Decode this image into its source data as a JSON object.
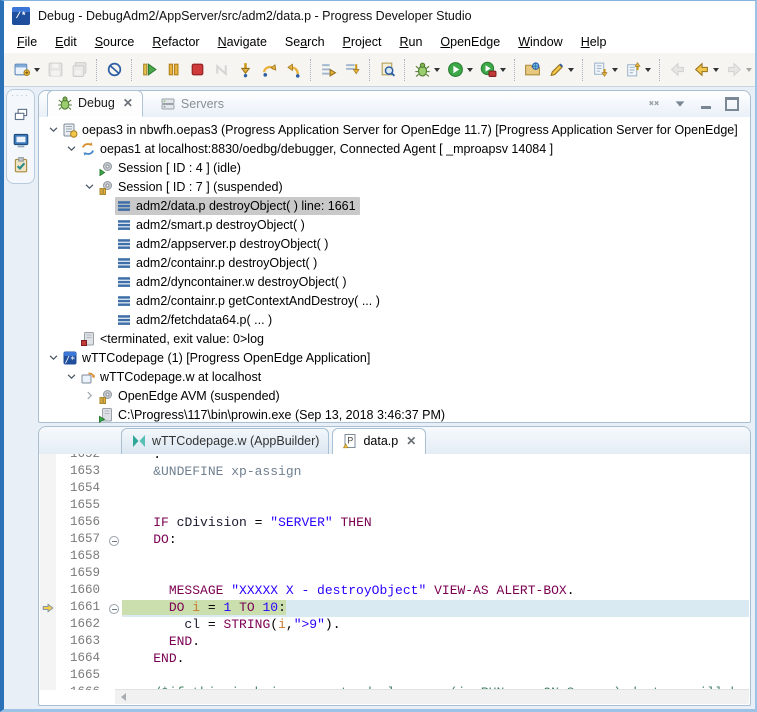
{
  "window": {
    "title": "Debug - DebugAdm2/AppServer/src/adm2/data.p - Progress Developer Studio",
    "app_icon": "progress-developer-studio-icon"
  },
  "menu": {
    "items": [
      {
        "label": "File",
        "u": 0
      },
      {
        "label": "Edit",
        "u": 0
      },
      {
        "label": "Source",
        "u": 0
      },
      {
        "label": "Refactor",
        "u": 0
      },
      {
        "label": "Navigate",
        "u": 0
      },
      {
        "label": "Search",
        "u": 2
      },
      {
        "label": "Project",
        "u": 0
      },
      {
        "label": "Run",
        "u": 0
      },
      {
        "label": "OpenEdge",
        "u": 0
      },
      {
        "label": "Window",
        "u": 0
      },
      {
        "label": "Help",
        "u": 0
      }
    ]
  },
  "toolbar": {
    "groups": [
      {
        "buttons": [
          {
            "name": "new-wizard",
            "icon": "new",
            "dropdown": true
          },
          {
            "name": "save",
            "icon": "save",
            "disabled": true
          },
          {
            "name": "save-all",
            "icon": "save-all",
            "disabled": true
          }
        ]
      },
      {
        "buttons": [
          {
            "name": "skip-all-breakpoints",
            "icon": "skip-bp"
          }
        ]
      },
      {
        "buttons": [
          {
            "name": "resume",
            "icon": "resume"
          },
          {
            "name": "suspend",
            "icon": "suspend"
          },
          {
            "name": "terminate",
            "icon": "terminate"
          },
          {
            "name": "disconnect",
            "icon": "disconnect",
            "disabled": true
          },
          {
            "name": "step-into",
            "icon": "step-into"
          },
          {
            "name": "step-over",
            "icon": "step-over"
          },
          {
            "name": "step-return",
            "icon": "step-return"
          }
        ]
      },
      {
        "buttons": [
          {
            "name": "use-step-filters",
            "icon": "step-filters"
          },
          {
            "name": "step-into-selection",
            "icon": "step-into-sel"
          }
        ]
      },
      {
        "buttons": [
          {
            "name": "inspect",
            "icon": "inspect"
          }
        ]
      },
      {
        "buttons": [
          {
            "name": "debug",
            "icon": "debug",
            "dropdown": true
          },
          {
            "name": "run",
            "icon": "run",
            "dropdown": true
          },
          {
            "name": "profile",
            "icon": "profile",
            "dropdown": true
          }
        ]
      },
      {
        "buttons": [
          {
            "name": "open-resource",
            "icon": "open-resource"
          },
          {
            "name": "highlight",
            "icon": "highlight",
            "dropdown": true
          }
        ]
      },
      {
        "buttons": [
          {
            "name": "next-annotation",
            "icon": "next-ann",
            "dropdown": true
          },
          {
            "name": "previous-annotation",
            "icon": "prev-ann",
            "dropdown": true
          }
        ]
      },
      {
        "buttons": [
          {
            "name": "back-disabled",
            "icon": "back-gray",
            "disabled": true
          },
          {
            "name": "back",
            "icon": "back",
            "dropdown": true
          },
          {
            "name": "forward",
            "icon": "forward",
            "disabled": true,
            "dropdown": true
          }
        ]
      }
    ]
  },
  "left_rail": {
    "icons": [
      "restore-views-icon",
      "console-view-icon",
      "tasks-view-icon"
    ]
  },
  "debug_view": {
    "tabs": [
      {
        "label": "Debug",
        "icon": "bug-icon",
        "active": true,
        "closable": true
      },
      {
        "label": "Servers",
        "icon": "servers-icon",
        "active": false
      }
    ],
    "toolbar_icons": [
      "remove-all-terminated-icon",
      "view-menu-icon",
      "minimize-icon",
      "maximize-icon"
    ],
    "tree": [
      {
        "indent": 0,
        "exp": "open",
        "icon": "oe-server",
        "label": "oepas3 in nbwfh.oepas3 (Progress Application Server for OpenEdge 11.7) [Progress Application Server for OpenEdge]"
      },
      {
        "indent": 1,
        "exp": "open",
        "icon": "agent",
        "label": "oepas1 at localhost:8830/oedbg/debugger, Connected Agent [ _mproapsv 14084 ]"
      },
      {
        "indent": 2,
        "exp": null,
        "icon": "session-idle",
        "label": "Session [ ID : 4 ] (idle)"
      },
      {
        "indent": 2,
        "exp": "open",
        "icon": "session-susp",
        "label": "Session [ ID : 7 ] (suspended)"
      },
      {
        "indent": 3,
        "exp": null,
        "icon": "stack-frame",
        "label": "adm2/data.p destroyObject( ) line: 1661",
        "selected": true
      },
      {
        "indent": 3,
        "exp": null,
        "icon": "stack-frame",
        "label": "adm2/smart.p destroyObject( )"
      },
      {
        "indent": 3,
        "exp": null,
        "icon": "stack-frame",
        "label": "adm2/appserver.p destroyObject( )"
      },
      {
        "indent": 3,
        "exp": null,
        "icon": "stack-frame",
        "label": "adm2/containr.p destroyObject( )"
      },
      {
        "indent": 3,
        "exp": null,
        "icon": "stack-frame",
        "label": "adm2/dyncontainer.w destroyObject( )"
      },
      {
        "indent": 3,
        "exp": null,
        "icon": "stack-frame",
        "label": "adm2/containr.p getContextAndDestroy( ... )"
      },
      {
        "indent": 3,
        "exp": null,
        "icon": "stack-frame",
        "label": "adm2/fetchdata64.p( ... )"
      },
      {
        "indent": 1,
        "exp": null,
        "icon": "terminated",
        "label": "<terminated, exit value: 0>log"
      },
      {
        "indent": 0,
        "exp": "open",
        "icon": "progress-app",
        "label": "wTTCodepage (1) [Progress OpenEdge Application]"
      },
      {
        "indent": 1,
        "exp": "open",
        "icon": "launch-target",
        "label": "wTTCodepage.w at localhost"
      },
      {
        "indent": 2,
        "exp": "closed",
        "icon": "avm-thread",
        "label": "OpenEdge AVM (suspended)"
      },
      {
        "indent": 2,
        "exp": null,
        "icon": "process",
        "label": "C:\\Progress\\117\\bin\\prowin.exe (Sep 13, 2018 3:46:37 PM)"
      }
    ]
  },
  "editor": {
    "tabs": [
      {
        "label": "wTTCodepage.w (AppBuilder)",
        "icon": "appbuilder",
        "active": false
      },
      {
        "label": "data.p",
        "icon": "ablfile",
        "active": true,
        "closable": true
      }
    ],
    "current_line": 1661,
    "colors": {
      "keyword": "#7B0052",
      "string": "#2A00FF",
      "number": "#2A00FF",
      "variable": "#C87A2E",
      "identifier": "#1A1A2E",
      "preprocessor": "#708090",
      "comment": "#3F7F5F",
      "current_line_bg": "#D9EAF2",
      "current_stmt_bg": "#CBDFAE"
    },
    "lines": [
      {
        "num": 1652,
        "tokens": [
          {
            "c": "p",
            "s": "    ."
          }
        ]
      },
      {
        "num": 1653,
        "tokens": [
          {
            "c": "pre",
            "s": "    &UNDEFINE xp-assign"
          }
        ]
      },
      {
        "num": 1654,
        "tokens": []
      },
      {
        "num": 1655,
        "tokens": []
      },
      {
        "num": 1656,
        "tokens": [
          {
            "c": "p",
            "s": "    "
          },
          {
            "c": "kw",
            "s": "IF"
          },
          {
            "c": "p",
            "s": " "
          },
          {
            "c": "id",
            "s": "cDivision"
          },
          {
            "c": "p",
            "s": " = "
          },
          {
            "c": "str",
            "s": "\"SERVER\""
          },
          {
            "c": "p",
            "s": " "
          },
          {
            "c": "kw",
            "s": "THEN"
          }
        ]
      },
      {
        "num": 1657,
        "fold": true,
        "tokens": [
          {
            "c": "p",
            "s": "    "
          },
          {
            "c": "kw",
            "s": "DO"
          },
          {
            "c": "p",
            "s": ":"
          }
        ]
      },
      {
        "num": 1658,
        "tokens": []
      },
      {
        "num": 1659,
        "tokens": []
      },
      {
        "num": 1660,
        "tokens": [
          {
            "c": "p",
            "s": "      "
          },
          {
            "c": "kw",
            "s": "MESSAGE"
          },
          {
            "c": "p",
            "s": " "
          },
          {
            "c": "str",
            "s": "\"XXXXX X - destroyObject\""
          },
          {
            "c": "p",
            "s": " "
          },
          {
            "c": "kw",
            "s": "VIEW-AS"
          },
          {
            "c": "p",
            "s": " "
          },
          {
            "c": "kw",
            "s": "ALERT-BOX"
          },
          {
            "c": "p",
            "s": "."
          }
        ]
      },
      {
        "num": 1661,
        "fold": true,
        "current": true,
        "tokens": [
          {
            "c": "p",
            "s": "      "
          },
          {
            "c": "kw",
            "s": "DO"
          },
          {
            "c": "p",
            "s": " "
          },
          {
            "c": "var",
            "s": "i"
          },
          {
            "c": "p",
            "s": " = "
          },
          {
            "c": "num",
            "s": "1"
          },
          {
            "c": "p",
            "s": " "
          },
          {
            "c": "kw",
            "s": "TO"
          },
          {
            "c": "p",
            "s": " "
          },
          {
            "c": "num",
            "s": "10"
          },
          {
            "c": "p",
            "s": ":"
          }
        ]
      },
      {
        "num": 1662,
        "tokens": [
          {
            "c": "p",
            "s": "        "
          },
          {
            "c": "id",
            "s": "cl"
          },
          {
            "c": "p",
            "s": " = "
          },
          {
            "c": "kw",
            "s": "STRING"
          },
          {
            "c": "p",
            "s": "("
          },
          {
            "c": "var",
            "s": "i"
          },
          {
            "c": "p",
            "s": ","
          },
          {
            "c": "str",
            "s": "\">9\""
          },
          {
            "c": "p",
            "s": ")."
          }
        ]
      },
      {
        "num": 1663,
        "tokens": [
          {
            "c": "p",
            "s": "      "
          },
          {
            "c": "kw",
            "s": "END"
          },
          {
            "c": "p",
            "s": "."
          }
        ]
      },
      {
        "num": 1664,
        "tokens": [
          {
            "c": "p",
            "s": "    "
          },
          {
            "c": "kw",
            "s": "END"
          },
          {
            "c": "p",
            "s": "."
          }
        ]
      },
      {
        "num": 1665,
        "tokens": []
      },
      {
        "num": 1666,
        "tokens": [
          {
            "c": "p",
            "s": "    "
          },
          {
            "c": "cm",
            "s": "/*if this is being run stand-alone or (in RUN ... ON Server) destroy will be called at*/"
          }
        ]
      }
    ]
  }
}
